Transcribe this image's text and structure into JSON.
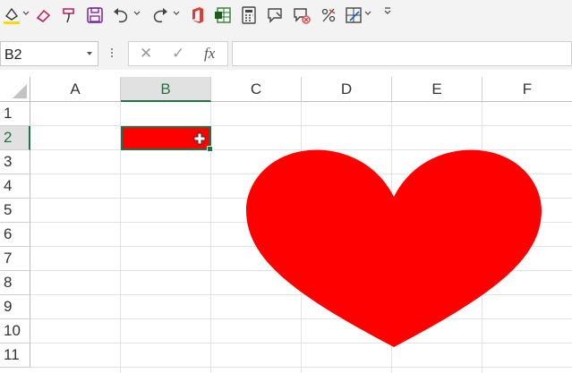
{
  "toolbar": {
    "items": [
      "fill-color-icon",
      "eraser-icon",
      "format-painter-icon",
      "save-icon",
      "undo-icon",
      "redo-icon",
      "office-icon",
      "sheet-icon",
      "calculator-icon",
      "comment-icon",
      "delete-comment-icon",
      "percent-icon",
      "border-icon",
      "more-icon"
    ]
  },
  "formula_bar": {
    "name_box": "B2",
    "cancel": "✕",
    "enter": "✓",
    "fx": "fx",
    "formula": ""
  },
  "sheet": {
    "columns": [
      "A",
      "B",
      "C",
      "D",
      "E",
      "F"
    ],
    "rows": [
      "1",
      "2",
      "3",
      "4",
      "5",
      "6",
      "7",
      "8",
      "9",
      "10",
      "11"
    ],
    "selected_cell": "B2",
    "selected_cell_fill": "#ff0000",
    "shape": {
      "kind": "heart",
      "color": "#ff0000"
    }
  },
  "colors": {
    "accent": "#217346",
    "heart": "#ff0000",
    "cell_fill": "#ff0000"
  }
}
